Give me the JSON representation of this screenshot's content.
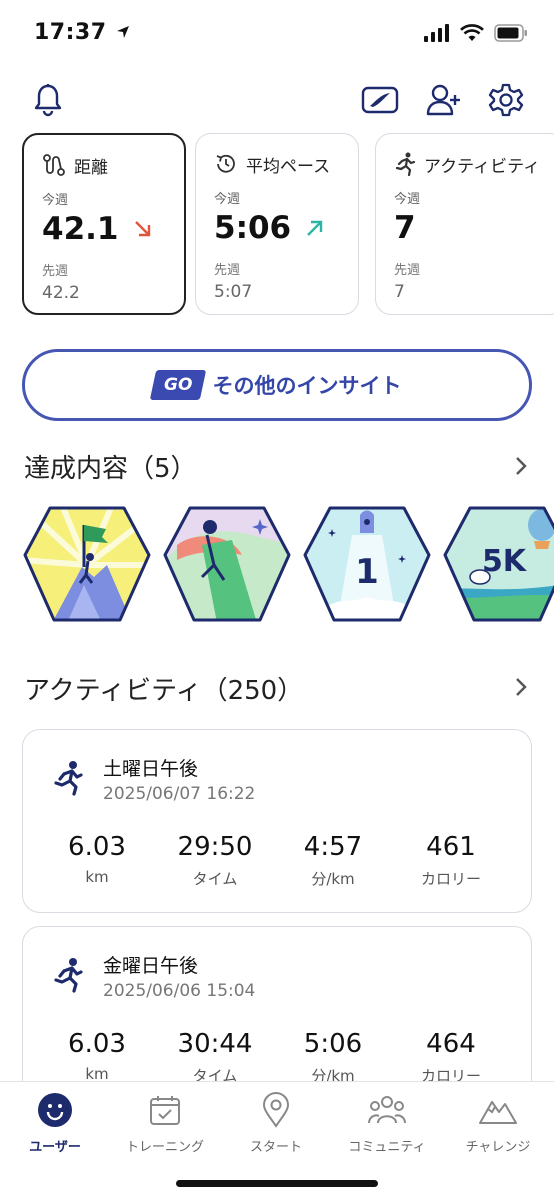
{
  "status_bar": {
    "time": "17:37"
  },
  "header": {
    "icons": [
      "bell-icon",
      "brand-logo-icon",
      "add-user-icon",
      "gear-icon"
    ],
    "accent_color": "#1d2a6b"
  },
  "stats": [
    {
      "label": "距離",
      "this_week_label": "今週",
      "value": "42.1",
      "trend": "down",
      "last_week_label": "先週",
      "last_value": "42.2"
    },
    {
      "label": "平均ペース",
      "this_week_label": "今週",
      "value": "5:06",
      "trend": "up",
      "last_week_label": "先週",
      "last_value": "5:07"
    },
    {
      "label": "アクティビティ",
      "this_week_label": "今週",
      "value": "7",
      "trend": "",
      "last_week_label": "先週",
      "last_value": "7"
    }
  ],
  "insights": {
    "badge": "GO",
    "label": "その他のインサイト"
  },
  "achievements": {
    "title": "達成内容（5）"
  },
  "activities": {
    "title": "アクティビティ（250）",
    "items": [
      {
        "title": "土曜日午後",
        "date": "2025/06/07 16:22",
        "metrics": [
          {
            "value": "6.03",
            "unit": "km"
          },
          {
            "value": "29:50",
            "unit": "タイム"
          },
          {
            "value": "4:57",
            "unit": "分/km"
          },
          {
            "value": "461",
            "unit": "カロリー"
          }
        ]
      },
      {
        "title": "金曜日午後",
        "date": "2025/06/06 15:04",
        "metrics": [
          {
            "value": "6.03",
            "unit": "km"
          },
          {
            "value": "30:44",
            "unit": "タイム"
          },
          {
            "value": "5:06",
            "unit": "分/km"
          },
          {
            "value": "464",
            "unit": "カロリー"
          }
        ]
      }
    ]
  },
  "badges": [
    {
      "icon": "summit-flag-badge-icon"
    },
    {
      "icon": "runner-ribbon-badge-icon"
    },
    {
      "icon": "rocket-first-badge-icon",
      "text": "1"
    },
    {
      "icon": "5k-badge-icon",
      "text": "5K"
    }
  ],
  "bottom_nav": [
    {
      "label": "ユーザー",
      "icon": "user-face-icon",
      "active": true
    },
    {
      "label": "トレーニング",
      "icon": "calendar-check-icon",
      "active": false
    },
    {
      "label": "スタート",
      "icon": "location-pin-icon",
      "active": false
    },
    {
      "label": "コミュニティ",
      "icon": "community-icon",
      "active": false
    },
    {
      "label": "チャレンジ",
      "icon": "mountain-icon",
      "active": false
    }
  ],
  "colors": {
    "trend_down": "#e0553a",
    "trend_up": "#2bb5a6",
    "brand": "#3a4ab1",
    "nav_active": "#1d2a6b"
  }
}
